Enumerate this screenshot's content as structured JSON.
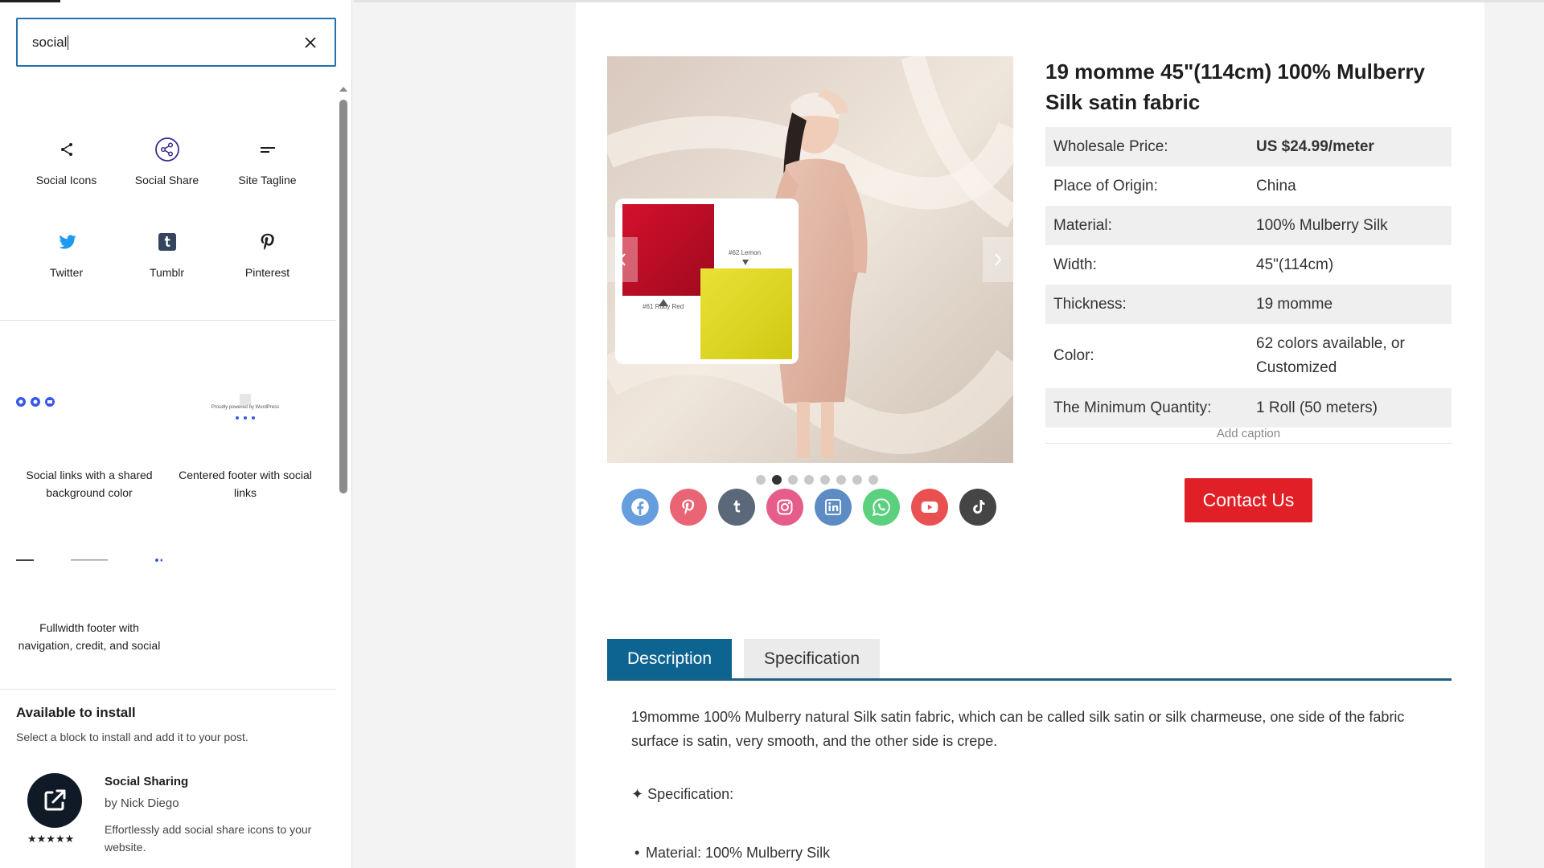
{
  "search": {
    "value": "social"
  },
  "blocks": [
    {
      "label": "Social Icons",
      "icon": "share-icon"
    },
    {
      "label": "Social Share",
      "icon": "social-share-icon"
    },
    {
      "label": "Site Tagline",
      "icon": "tagline-icon"
    },
    {
      "label": "Twitter",
      "icon": "twitter-icon"
    },
    {
      "label": "Tumblr",
      "icon": "tumblr-icon"
    },
    {
      "label": "Pinterest",
      "icon": "pinterest-icon"
    }
  ],
  "patterns": [
    {
      "label": "Social links with a shared background color"
    },
    {
      "label": "Centered footer with social links",
      "thumb_text": "Proudly powered by WordPress"
    },
    {
      "label": "Fullwidth footer with navigation, credit, and social"
    }
  ],
  "install": {
    "heading": "Available to install",
    "desc": "Select a block to install and add it to your post.",
    "plugin": {
      "name": "Social Sharing",
      "author": "by Nick Diego",
      "desc": "Effortlessly add social share icons to your website.",
      "stars": "★★★★★"
    }
  },
  "product": {
    "title": "19 momme 45\"(114cm) 100% Mulberry Silk satin fabric",
    "specs": [
      {
        "key": "Wholesale Price:",
        "value": "US $24.99/meter"
      },
      {
        "key": "Place of Origin:",
        "value": "China"
      },
      {
        "key": "Material:",
        "value": "100% Mulberry Silk"
      },
      {
        "key": "Width:",
        "value": "45\"(114cm)"
      },
      {
        "key": "Thickness:",
        "value": "19 momme"
      },
      {
        "key": "Color:",
        "value": "62 colors available, or Customized"
      },
      {
        "key": "The Minimum Quantity:",
        "value": "1 Roll (50 meters)"
      }
    ],
    "caption": "Add caption",
    "contact_label": "Contact Us",
    "swatch_labels": {
      "red": "#61 Ruby Red",
      "yellow": "#62 Lemon"
    }
  },
  "tabs": [
    {
      "label": "Description"
    },
    {
      "label": "Specification"
    }
  ],
  "content": {
    "description": "19momme 100% Mulberry natural Silk satin fabric, which can be called silk satin or silk charmeuse, one side of the fabric surface is satin, very smooth, and the other side is crepe.",
    "spec_heading": "✦ Specification:",
    "spec_items": [
      "Material: 100% Mulberry Silk"
    ]
  },
  "gallery": {
    "dot_count": 8,
    "active_dot": 1
  },
  "social_icons": [
    {
      "name": "facebook-icon",
      "color": "#3b82d6"
    },
    {
      "name": "pinterest-icon",
      "color": "#e43b50"
    },
    {
      "name": "tumblr-icon",
      "color": "#2d3e55"
    },
    {
      "name": "instagram-icon",
      "color": "#e0306b"
    },
    {
      "name": "linkedin-icon",
      "color": "#2f6db3"
    },
    {
      "name": "whatsapp-icon",
      "color": "#2ec45a"
    },
    {
      "name": "youtube-icon",
      "color": "#e32121"
    },
    {
      "name": "tiktok-icon",
      "color": "#111111"
    }
  ],
  "colors": {
    "accent": "#2271b1",
    "contact": "#e01f26",
    "tab_active": "#0e6491"
  }
}
